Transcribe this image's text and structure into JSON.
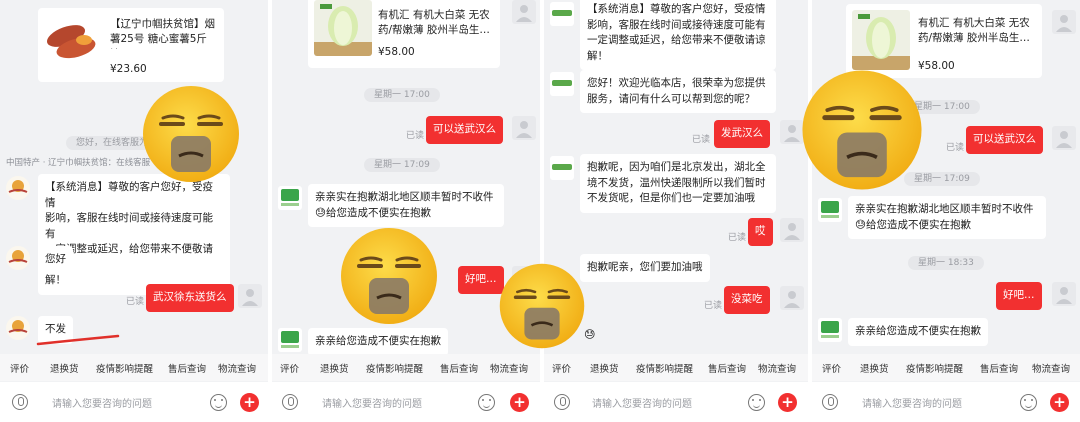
{
  "colors": {
    "accent": "#f23030",
    "bg": "#f1f2f4",
    "bubble": "#ffffff",
    "emoji": "#f9c52a"
  },
  "tabs": [
    "评价",
    "退换货",
    "疫情影响提醒",
    "售后查询",
    "物流查询"
  ],
  "input": {
    "placeholder": "请输入您要咨询的问题"
  },
  "read_label": "已读",
  "system_msg": "【系统消息】尊敬的客户您好，受疫情影响，客服在线时间或接待速度可能有一定调整或延迟，给您带来不便敬请谅解！",
  "panel1": {
    "product_title": "【辽宁巾帼扶贫馆】烟薯25号 糖心蜜薯5斤 沙…",
    "product_price": "¥23.60",
    "time_pill": "您好，在线客服为您服务",
    "shop_line": "中国特产 · 辽宁巾帼扶贫馆：在线客服",
    "system_msg_lines": [
      "【系统消息】尊敬的客户您好，受疫情",
      "影响，客服在线时间或接待速度可能有",
      "一定调整或延迟，给您带来不便敬请谅",
      "解！"
    ],
    "seller_hello": "您好",
    "buyer_msg": "武汉徐东送货么",
    "seller_reply": "不发"
  },
  "panel2": {
    "product_title_lines": [
      "有机汇 有机大白菜 无农",
      "药/帮嫩薄 胶州半岛生…"
    ],
    "product_price": "¥58.00",
    "time1": "星期一 17:00",
    "buyer_msg": "可以送武汉么",
    "time2": "星期一 17:09",
    "seller_reply_lines": [
      "亲亲实在抱歉湖北地区顺丰暂时不收件",
      "😓给您造成不便实在抱歉"
    ],
    "buyer_msg2": "好吧…",
    "seller_reply2": "亲亲给您造成不便实在抱歉"
  },
  "panel3": {
    "system_msg_lines": [
      "【系统消息】尊敬的客户您好，受疫情",
      "影响，客服在线时间或接待速度可能有",
      "一定调整或延迟，给您带来不便敬请谅",
      "解！"
    ],
    "welcome_lines": [
      "您好！欢迎光临本店，很荣幸为您提供",
      "服务，请问有什么可以帮到您的呢？"
    ],
    "buyer_msg": "发武汉么",
    "reply_lines": [
      "抱歉呢，因为咱们是北京发出，湖北全",
      "境不发货，温州快递限制所以我们暂时",
      "不发货呢，但是你们也一定要加油哦"
    ],
    "buyer_msg2": "哎",
    "reply2": "抱歉呢亲，您们要加油哦",
    "buyer_msg3": "没菜吃",
    "tiny_emoji": "😓"
  },
  "panel4": {
    "product_title_lines": [
      "有机汇 有机大白菜 无农",
      "药/帮嫩薄 胶州半岛生…"
    ],
    "product_price": "¥58.00",
    "time1": "星期一 17:00",
    "buyer_msg": "可以送武汉么",
    "time2": "星期一 17:09",
    "seller_reply_lines": [
      "亲亲实在抱歉湖北地区顺丰暂时不收件",
      "😓给您造成不便实在抱歉"
    ],
    "time3": "星期一 18:33",
    "buyer_msg2": "好吧…",
    "seller_reply2": "亲亲给您造成不便实在抱歉"
  }
}
